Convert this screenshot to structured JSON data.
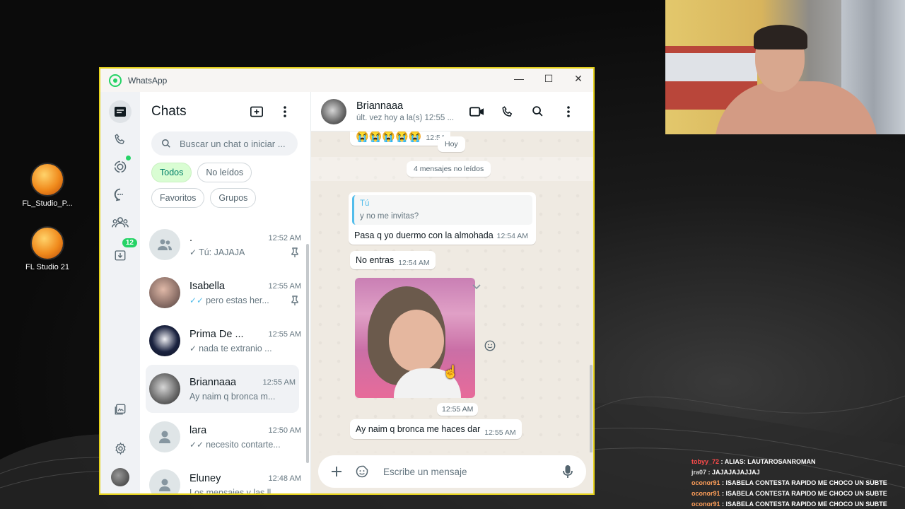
{
  "desktop": {
    "icons": [
      {
        "label": "FL_Studio_P..."
      },
      {
        "label": "FL Studio 21"
      }
    ]
  },
  "stream_chat": [
    {
      "user": "tobyy_72",
      "message": ": ALIAS: LAUTAROSANROMAN"
    },
    {
      "user": "jra07",
      "message": ": JAJAJAJAJJAJ"
    },
    {
      "user": "oconor91",
      "message": ": ISABELA CONTESTA RAPIDO ME CHOCO UN SUBTE"
    },
    {
      "user": "oconor91",
      "message": ": ISABELA CONTESTA RAPIDO ME CHOCO UN SUBTE"
    },
    {
      "user": "oconor91",
      "message": ": ISABELA CONTESTA RAPIDO ME CHOCO UN SUBTE"
    }
  ],
  "window": {
    "title": "WhatsApp",
    "controls": {
      "minimize": "—",
      "maximize": "☐",
      "close": "✕"
    }
  },
  "rail": {
    "archived_badge": "12"
  },
  "chatlist": {
    "title": "Chats",
    "search_placeholder": "Buscar un chat o iniciar ...",
    "filters": [
      "Todos",
      "No leídos",
      "Favoritos",
      "Grupos"
    ],
    "chats": [
      {
        "name": ".",
        "time": "12:52 AM",
        "preview": "Tú: JAJAJA",
        "tick": "✓",
        "pinned": true
      },
      {
        "name": "Isabella",
        "time": "12:55 AM",
        "preview": "pero estas her...",
        "tick": "✓✓",
        "pinned": true
      },
      {
        "name": "Prima De ...",
        "time": "12:55 AM",
        "preview": "nada te extranio ...",
        "tick": "✓",
        "pinned": false
      },
      {
        "name": "Briannaaa",
        "time": "12:55 AM",
        "preview": "Ay naim q bronca m...",
        "tick": "",
        "pinned": false
      },
      {
        "name": "lara",
        "time": "12:50 AM",
        "preview": "necesito contarte...",
        "tick": "✓✓",
        "pinned": false
      },
      {
        "name": "Eluney",
        "time": "12:48 AM",
        "preview": "Los mensajes y las ll...",
        "tick": "",
        "pinned": false
      }
    ]
  },
  "conversation": {
    "contact_name": "Briannaaa",
    "status": "últ. vez hoy a la(s) 12:55 ...",
    "date_pill": "Hoy",
    "unread_pill": "4 mensajes no leídos",
    "messages": [
      {
        "text": "😭😭😭😭😭",
        "time": "12:54"
      },
      {
        "quote_author": "Tú",
        "quote_text": "y no me invitas?",
        "text": "Pasa q yo duermo con la almohada",
        "time": "12:54 AM"
      },
      {
        "text": "No entras",
        "time": "12:54 AM"
      },
      {
        "photo_time": "12:55 AM"
      },
      {
        "text": "Ay naim q bronca me haces dar",
        "time": "12:55 AM"
      }
    ],
    "composer_placeholder": "Escribe un mensaje"
  }
}
